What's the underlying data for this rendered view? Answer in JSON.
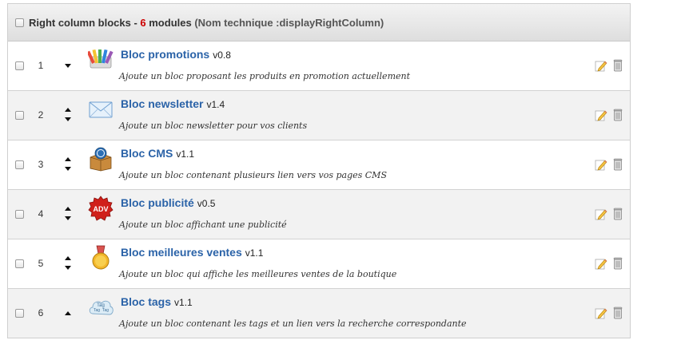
{
  "header": {
    "title": "Right column blocks",
    "separator": " - ",
    "count": "6",
    "modules_label": " modules",
    "technical": " (Nom technique :displayRightColumn)"
  },
  "modules": [
    {
      "position": "1",
      "name": "Bloc promotions",
      "version": "v0.8",
      "description": "Ajoute un bloc proposant les produits en promotion actuellement",
      "icon": "color-palette-icon"
    },
    {
      "position": "2",
      "name": "Bloc newsletter",
      "version": "v1.4",
      "description": "Ajoute un bloc newsletter pour vos clients",
      "icon": "envelope-icon"
    },
    {
      "position": "3",
      "name": "Bloc CMS",
      "version": "v1.1",
      "description": "Ajoute un bloc contenant plusieurs lien vers vos pages CMS",
      "icon": "cms-box-icon"
    },
    {
      "position": "4",
      "name": "Bloc publicité",
      "version": "v0.5",
      "description": "Ajoute un bloc affichant une publicité",
      "icon": "adv-badge-icon",
      "icon_text": "ADV"
    },
    {
      "position": "5",
      "name": "Bloc meilleures ventes",
      "version": "v1.1",
      "description": "Ajoute un bloc qui affiche les meilleures ventes de la boutique",
      "icon": "medal-icon"
    },
    {
      "position": "6",
      "name": "Bloc tags",
      "version": "v1.1",
      "description": "Ajoute un bloc contenant les tags et un lien vers la recherche correspondante",
      "icon": "tags-cloud-icon",
      "icon_text": "Tag"
    }
  ]
}
